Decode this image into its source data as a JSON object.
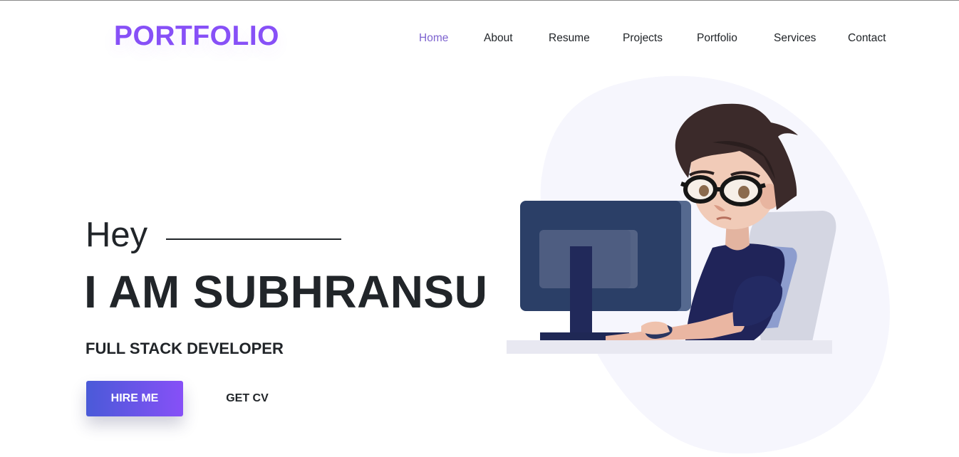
{
  "brand": {
    "logo": "PORTFOLIO",
    "accent": "#8750f7"
  },
  "nav": {
    "items": [
      {
        "label": "Home",
        "active": true
      },
      {
        "label": "About",
        "active": false
      },
      {
        "label": "Resume",
        "active": false
      },
      {
        "label": "Projects",
        "active": false
      },
      {
        "label": "Portfolio",
        "active": false
      },
      {
        "label": "Services",
        "active": false
      },
      {
        "label": "Contact",
        "active": false
      }
    ],
    "active_color": "#7d63cf"
  },
  "hero": {
    "greeting": "Hey",
    "name": "I AM SUBHRANSU",
    "role": "FULL STACK DEVELOPER",
    "hire_label": "HIRE ME",
    "cv_label": "GET CV",
    "illustration_icon": "developer-at-computer-illustration"
  }
}
